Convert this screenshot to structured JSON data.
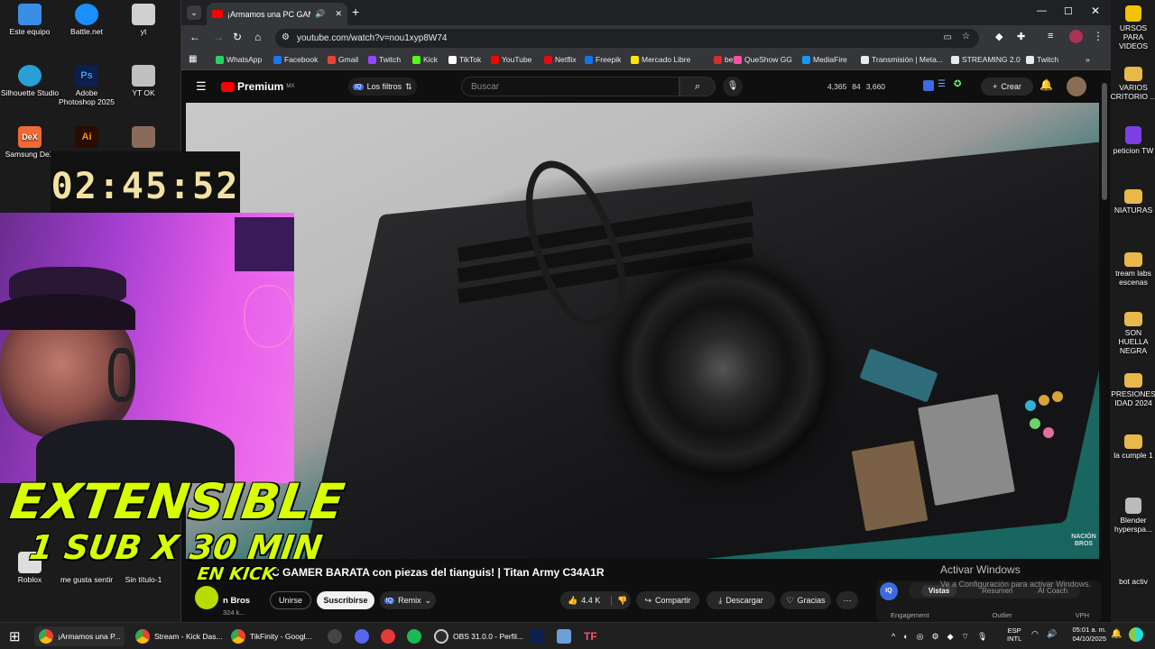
{
  "desktop": {
    "left_icons": [
      {
        "label": "Este equipo",
        "color": "#3a8ee6"
      },
      {
        "label": "Battle.net",
        "color": "#1a90ff"
      },
      {
        "label": "yt",
        "color": "#d0d0d0"
      },
      {
        "label": "Silhouette Studio",
        "color": "#2a9fd6"
      },
      {
        "label": "Adobe Photoshop 2025",
        "color": "#0d1f4f"
      },
      {
        "label": "YT OK",
        "color": "#c0c0c0"
      },
      {
        "label": "Samsung DeX",
        "color": "#f06a35"
      },
      {
        "label": "Adobe Illustrator",
        "color": "#2b0c00"
      },
      {
        "label": "Roblox",
        "color": "#dddddd"
      },
      {
        "label": "me gusta sentir",
        "color": "#dddddd"
      },
      {
        "label": "Sin título-1",
        "color": "#dddddd"
      }
    ],
    "right_icons": [
      {
        "label": "URSOS PARA VIDEOS",
        "color": "#f2c200"
      },
      {
        "label": "VARIOS CRITORIO ...",
        "color": "#e8b84a"
      },
      {
        "label": "peticion TW",
        "color": "#7b3fe4"
      },
      {
        "label": "NIATURAS",
        "color": "#e8b84a"
      },
      {
        "label": "tream labs escenas",
        "color": "#e8b84a"
      },
      {
        "label": "SON HUELLA NEGRA",
        "color": "#e8b84a"
      },
      {
        "label": "PRESIONES IDAD 2024",
        "color": "#e8b84a"
      },
      {
        "label": "la cumple 1",
        "color": "#e8b84a"
      },
      {
        "label": "Blender hyperspa...",
        "color": "#bbbbbb"
      },
      {
        "label": "bot activ",
        "color": "#3a8a3a"
      }
    ]
  },
  "browser": {
    "tab_title": "¡Armamos una PC GAMER",
    "url": "youtube.com/watch?v=nou1xyp8W74",
    "bookmarks": [
      {
        "label": "WhatsApp",
        "color": "#25d366"
      },
      {
        "label": "Facebook",
        "color": "#1877f2"
      },
      {
        "label": "Gmail",
        "color": "#ea4335"
      },
      {
        "label": "Twitch",
        "color": "#9146ff"
      },
      {
        "label": "Kick",
        "color": "#53fc18"
      },
      {
        "label": "TikTok",
        "color": "#ffffff"
      },
      {
        "label": "YouTube",
        "color": "#ff0000"
      },
      {
        "label": "Netflix",
        "color": "#e50914"
      },
      {
        "label": "Freepik",
        "color": "#1273eb"
      },
      {
        "label": "Mercado Libre",
        "color": "#ffe600"
      },
      {
        "label": "bet",
        "color": "#d32f2f"
      },
      {
        "label": "QueShow GG",
        "color": "#ff4fa3"
      },
      {
        "label": "MediaFire",
        "color": "#1299f3"
      },
      {
        "label": "Transmisión | Meta...",
        "color": "#e8eaed"
      },
      {
        "label": "STREAMING 2.0",
        "color": "#e8eaed"
      },
      {
        "label": "Twitch",
        "color": "#e8eaed"
      }
    ]
  },
  "youtube": {
    "logo": "Premium",
    "region": "MX",
    "filter_label": "Los filtros",
    "search_placeholder": "Buscar",
    "stats": {
      "a": "4,365",
      "b": "84",
      "c": "3,660"
    },
    "create_label": "Crear",
    "video_title": "C GAMER BARATA con piezas del tianguis! | Titan Army C34A1R",
    "watermark": "NACIÓN BROS",
    "channel_name": "n Bros",
    "channel_subs": "324 k...",
    "join_label": "Unirse",
    "subscribe_label": "Suscribirse",
    "remix_label": "Remix",
    "likes": "4.4 K",
    "share_label": "Compartir",
    "download_label": "Descargar",
    "thanks_label": "Gracias",
    "iq_tabs": [
      "Vistas",
      "Resumen",
      "AI Coach"
    ],
    "iq_cols": [
      "Engagement",
      "Outlier",
      "VPH"
    ],
    "iq_badge": "IQ"
  },
  "overlay": {
    "timer": "02:45:52",
    "promo_line1": "EXTENSIBLE",
    "promo_line2": "1 SUB X 30 MIN",
    "promo_line3": "EN KICK"
  },
  "windows_activation": {
    "title": "Activar Windows",
    "subtitle": "Ve a Configuración para activar Windows."
  },
  "taskbar": {
    "items": [
      {
        "label": "¡Armamos una P..."
      },
      {
        "label": "Stream - Kick Das..."
      },
      {
        "label": "TikFinity - Googl..."
      },
      {
        "label": ""
      },
      {
        "label": ""
      },
      {
        "label": ""
      },
      {
        "label": ""
      },
      {
        "label": "OBS 31.0.0 - Perfil..."
      }
    ],
    "lang1": "ESP",
    "lang2": "INTL",
    "time": "05:01 a. m.",
    "date": "04/10/2025"
  }
}
